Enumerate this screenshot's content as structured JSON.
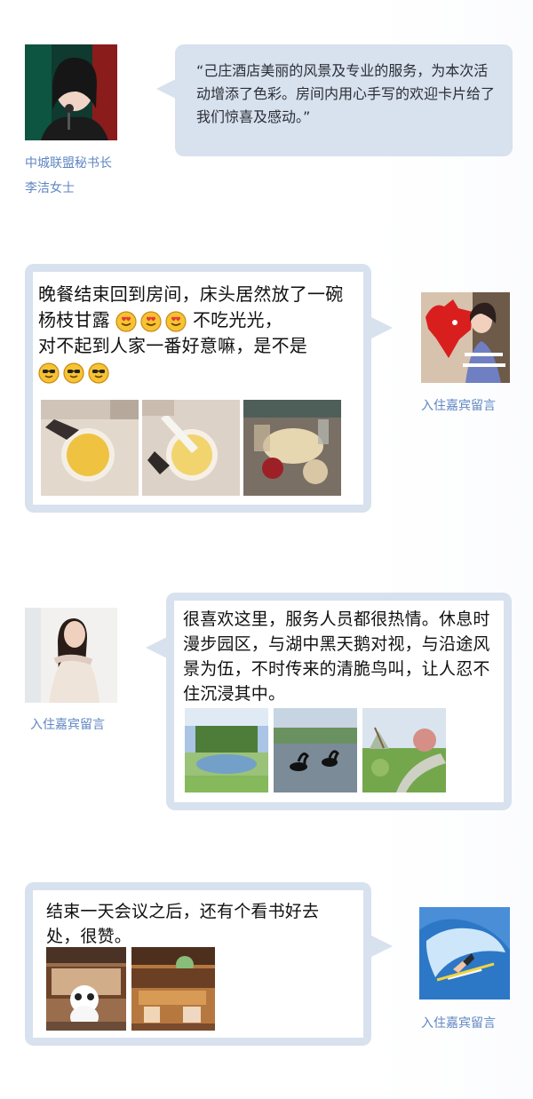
{
  "sections": [
    {
      "avatar_icon": "speaker-portrait-icon",
      "caption_lines": [
        "中城联盟秘书长",
        "李洁女士"
      ],
      "message": "“己庄酒店美丽的风景及专业的服务，为本次活动增添了色彩。房间内用心手写的欢迎卡片给了我们惊喜及感动。”"
    },
    {
      "avatar_icon": "guest-with-red-bull-icon",
      "caption": "入住嘉宾留言",
      "message_part1": "晚餐结束回到房间，床头居然放了一碗杨枝甘露",
      "message_part2": "不吃光光，",
      "message_part3": "对不起到人家一番好意嘛，是不是",
      "emojis_1": [
        "smiling-heart-eyes-icon",
        "smiling-heart-eyes-icon",
        "smiling-heart-eyes-icon"
      ],
      "emojis_2": [
        "sunglasses-face-icon",
        "sunglasses-face-icon",
        "sunglasses-face-icon"
      ],
      "photos": [
        "dessert-bowl-photo",
        "spoon-in-bowl-photo",
        "dining-table-photo"
      ]
    },
    {
      "avatar_icon": "woman-with-long-hair-icon",
      "caption": "入住嘉宾留言",
      "message": "很喜欢这里，服务人员都很热情。休息时漫步园区，与湖中黑天鹅对视，与沿途风景为伍，不时传来的清脆鸟叫，让人忍不住沉浸其中。",
      "photos": [
        "lakeside-garden-photo",
        "black-swans-lake-photo",
        "garden-pathway-photo"
      ]
    },
    {
      "avatar_icon": "surfer-wave-icon",
      "caption": "入住嘉宾留言",
      "message": "结束一天会议之后，还有个看书好去处，很赞。",
      "photos": [
        "library-panda-photo",
        "reading-room-photo"
      ]
    }
  ],
  "colors": {
    "caption": "#5f86c3",
    "bubble_border": "#d8e1ee",
    "bubble_fill": "#ffffff"
  }
}
